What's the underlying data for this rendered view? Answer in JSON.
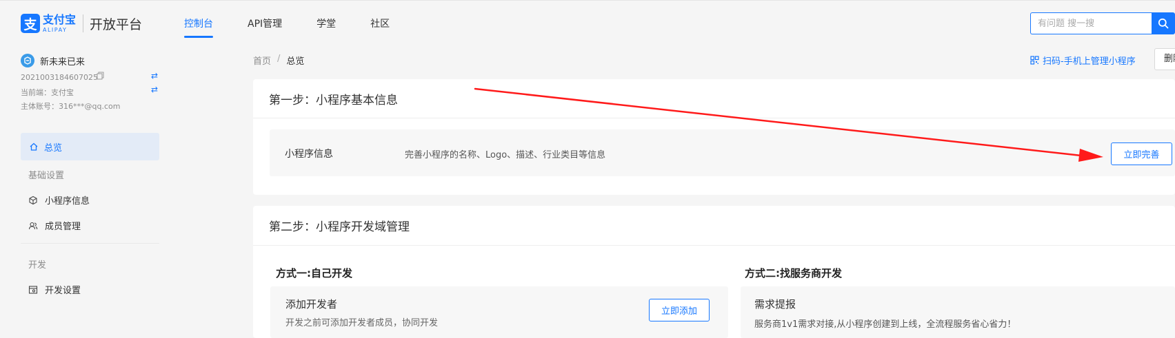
{
  "brand": {
    "logo_glyph": "支",
    "logo_cn": "支付宝",
    "logo_en": "ALIPAY",
    "platform": "开放平台",
    "color": "#1677ff"
  },
  "nav": {
    "items": [
      {
        "label": "控制台",
        "active": true
      },
      {
        "label": "API管理",
        "active": false
      },
      {
        "label": "学堂",
        "active": false
      },
      {
        "label": "社区",
        "active": false
      }
    ]
  },
  "search": {
    "placeholder": "有问题 搜一搜",
    "icon": "search-icon"
  },
  "sidebar": {
    "app_name": "新未来已来",
    "app_id": "2021003184607025",
    "current_client_label": "当前端：支付宝",
    "account_label": "主体账号：316***@qq.com",
    "overview": "总览",
    "groups": [
      {
        "label": "基础设置",
        "items": [
          "小程序信息",
          "成员管理"
        ]
      },
      {
        "label": "开发",
        "items": [
          "开发设置"
        ]
      }
    ]
  },
  "breadcrumb": {
    "home": "首页",
    "separator": "/",
    "current": "总览"
  },
  "header_actions": {
    "scan_link": "扫码-手机上管理小程序",
    "delete_button": "删除"
  },
  "step1": {
    "title": "第一步：小程序基本信息",
    "row_label": "小程序信息",
    "row_desc": "完善小程序的名称、Logo、描述、行业类目等信息",
    "action": "立即完善"
  },
  "step2": {
    "title": "第二步：小程序开发域管理",
    "method1": {
      "title": "方式一:自己开发",
      "item_title": "添加开发者",
      "item_desc": "开发之前可添加开发者成员，协同开发",
      "action": "立即添加"
    },
    "method2": {
      "title": "方式二:找服务商开发",
      "item_title": "需求提报",
      "item_desc": "服务商1v1需求对接,从小程序创建到上线，全流程服务省心省力！"
    }
  },
  "annotation": {
    "arrow_color": "#ff1a1a"
  }
}
